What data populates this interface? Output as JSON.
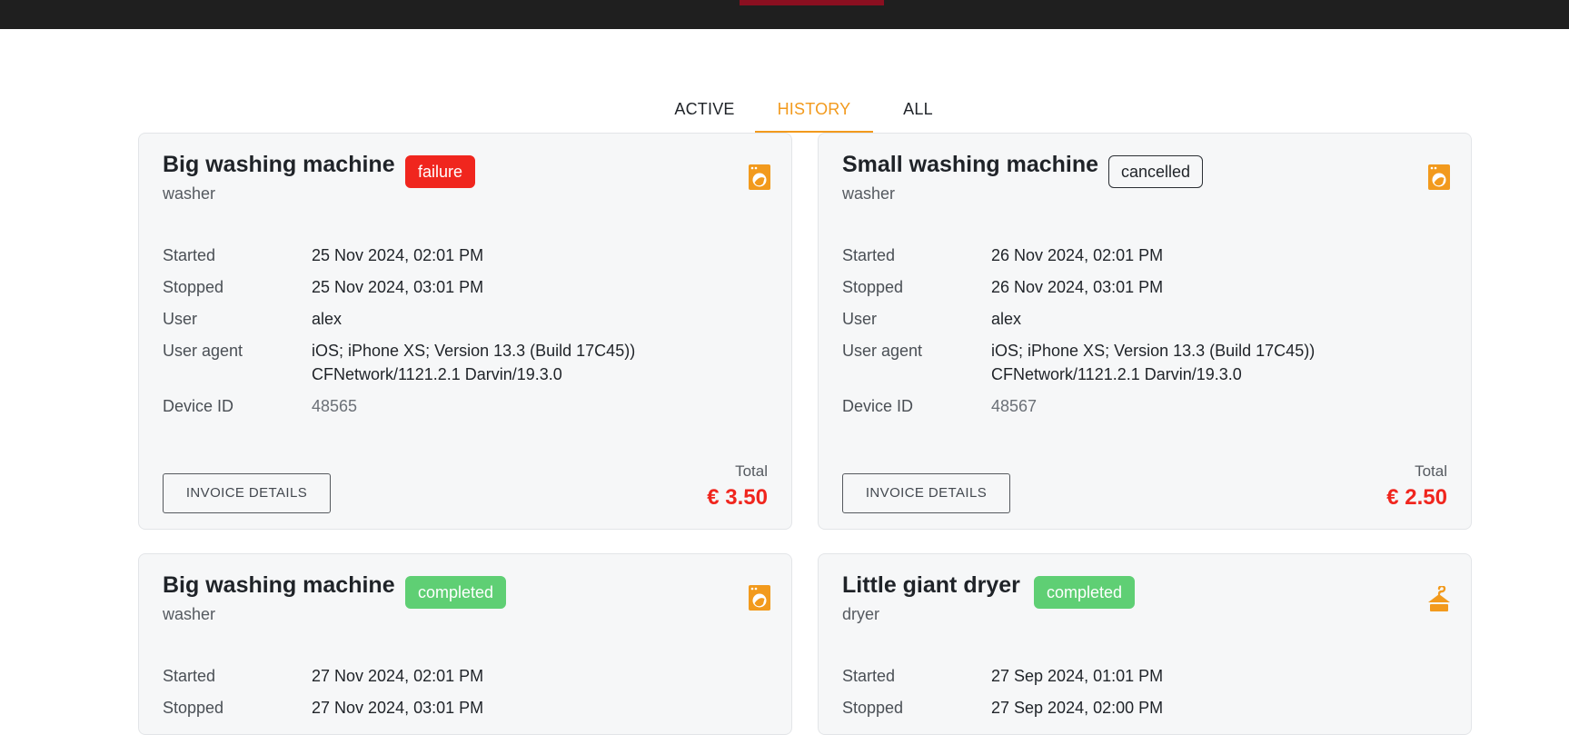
{
  "tabs": [
    {
      "label": "ACTIVE"
    },
    {
      "label": "HISTORY"
    },
    {
      "label": "ALL"
    }
  ],
  "labels": {
    "started": "Started",
    "stopped": "Stopped",
    "user": "User",
    "user_agent": "User agent",
    "device_id": "Device ID",
    "total": "Total",
    "invoice_button": "INVOICE DETAILS"
  },
  "cards": [
    {
      "title": "Big washing machine",
      "type": "washer",
      "status": "failure",
      "icon": "washer-icon",
      "started": "25 Nov 2024, 02:01 PM",
      "stopped": "25 Nov 2024, 03:01 PM",
      "user": "alex",
      "user_agent_line1": "iOS; iPhone XS; Version 13.3 (Build 17C45))",
      "user_agent_line2": "CFNetwork/1121.2.1 Darvin/19.3.0",
      "device_id": "48565",
      "total": "€ 3.50"
    },
    {
      "title": "Small washing machine",
      "type": "washer",
      "status": "cancelled",
      "icon": "washer-icon",
      "started": "26 Nov 2024, 02:01 PM",
      "stopped": "26 Nov 2024, 03:01 PM",
      "user": "alex",
      "user_agent_line1": "iOS; iPhone XS; Version 13.3 (Build 17C45))",
      "user_agent_line2": "CFNetwork/1121.2.1 Darvin/19.3.0",
      "device_id": "48567",
      "total": "€ 2.50"
    },
    {
      "title": "Big washing machine",
      "type": "washer",
      "status": "completed",
      "icon": "washer-icon",
      "started": "27 Nov 2024, 02:01 PM",
      "stopped": "27 Nov 2024, 03:01 PM"
    },
    {
      "title": "Little giant dryer",
      "type": "dryer",
      "status": "completed",
      "icon": "hanger-icon",
      "started": "27 Sep 2024, 01:01 PM",
      "stopped": "27 Sep 2024, 02:00 PM"
    }
  ],
  "colors": {
    "accent": "#f29a1d",
    "failure": "#f0261e",
    "completed": "#5fcf74",
    "topbar": "#1f1f1f",
    "topbar_accent": "#8a0f20"
  }
}
